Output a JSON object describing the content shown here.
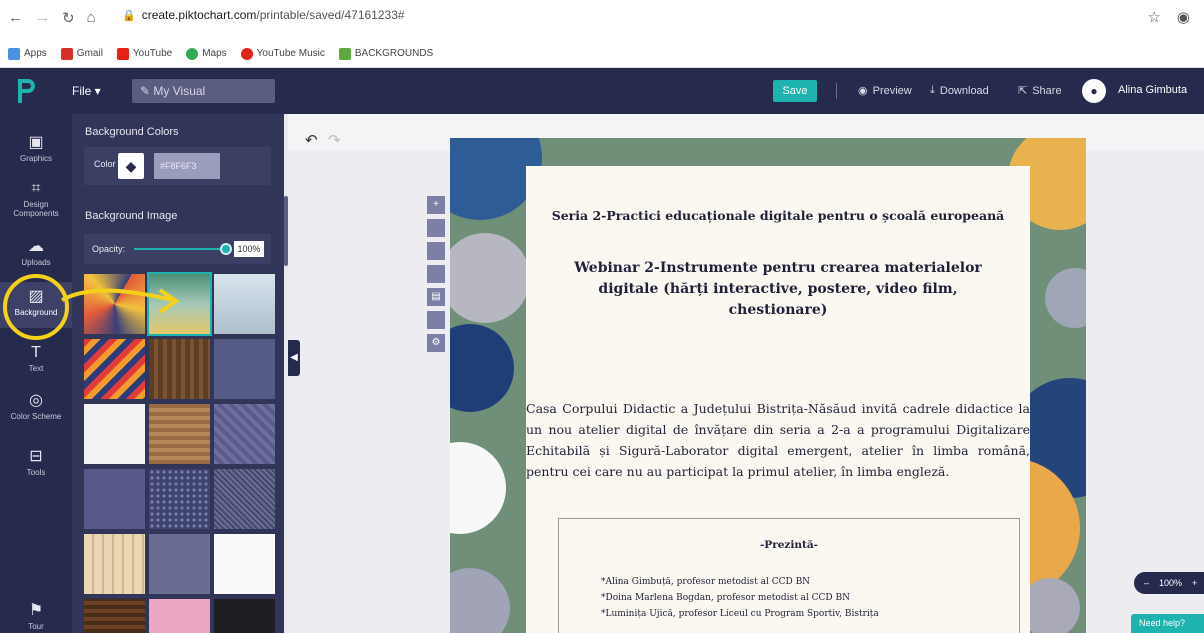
{
  "browser": {
    "url_host": "create.piktochart.com",
    "url_path": "/printable/saved/47161233#",
    "bookmarks": [
      {
        "label": "Apps",
        "color": "#4a90e2"
      },
      {
        "label": "Gmail",
        "color": "#d93025"
      },
      {
        "label": "YouTube",
        "color": "#e62117"
      },
      {
        "label": "Maps",
        "color": "#34a853"
      },
      {
        "label": "YouTube Music",
        "color": "#e62117"
      },
      {
        "label": "BACKGROUNDS",
        "color": "#5cab3c"
      }
    ]
  },
  "app_bar": {
    "file_label": "File ▾",
    "visual_name": "My Visual",
    "save_label": "Save",
    "preview_label": "Preview",
    "download_label": "Download",
    "share_label": "Share",
    "user_name": "Alina Gimbuta"
  },
  "rail": [
    {
      "id": "graphics",
      "label": "Graphics",
      "icon": "image-icon"
    },
    {
      "id": "design-components",
      "label": "Design Components",
      "icon": "components-icon"
    },
    {
      "id": "uploads",
      "label": "Uploads",
      "icon": "upload-cloud-icon"
    },
    {
      "id": "background",
      "label": "Background",
      "icon": "background-icon"
    },
    {
      "id": "text",
      "label": "Text",
      "icon": "text-icon"
    },
    {
      "id": "color-scheme",
      "label": "Color Scheme",
      "icon": "palette-icon"
    },
    {
      "id": "tools",
      "label": "Tools",
      "icon": "toolbox-icon"
    },
    {
      "id": "tour",
      "label": "Tour",
      "icon": "signpost-icon"
    }
  ],
  "panel": {
    "bg_colors_title": "Background Colors",
    "color_label": "Color",
    "color_hex": "#F8F6F3",
    "bg_image_title": "Background Image",
    "opacity_label": "Opacity:",
    "opacity_value": "100%",
    "opacity_fraction": 1.0
  },
  "poster": {
    "series_title": "Seria 2-Practici educaționale digitale pentru o școală europeană",
    "webinar_line1": "Webinar 2-Instrumente pentru crearea materialelor",
    "webinar_line2": "digitale (hărți interactive, postere, video film,",
    "webinar_line3": "chestionare)",
    "body": "Casa Corpului Didactic a Județului Bistrița-Năsăud invită cadrele didactice la un nou atelier digital de învățare din seria a 2-a a programului Digitalizare Echitabilă și Sigură-Laborator digital emergent, atelier în limba română, pentru cei care nu au participat la primul atelier, în limba engleză.",
    "present_label": "-Prezintă-",
    "presenters": [
      "*Alina Gimbuță, profesor metodist al CCD BN",
      "*Doina Marlena Bogdan, profesor metodist al CCD BN",
      "*Luminița Ujică, profesor Liceul cu Program Sportiv, Bistrița"
    ]
  },
  "zoom_value": "100%",
  "help_label": "Need help?",
  "colors": {
    "navy": "#262a4d",
    "teal": "#1fb3b0",
    "highlight": "#f5d21a"
  }
}
